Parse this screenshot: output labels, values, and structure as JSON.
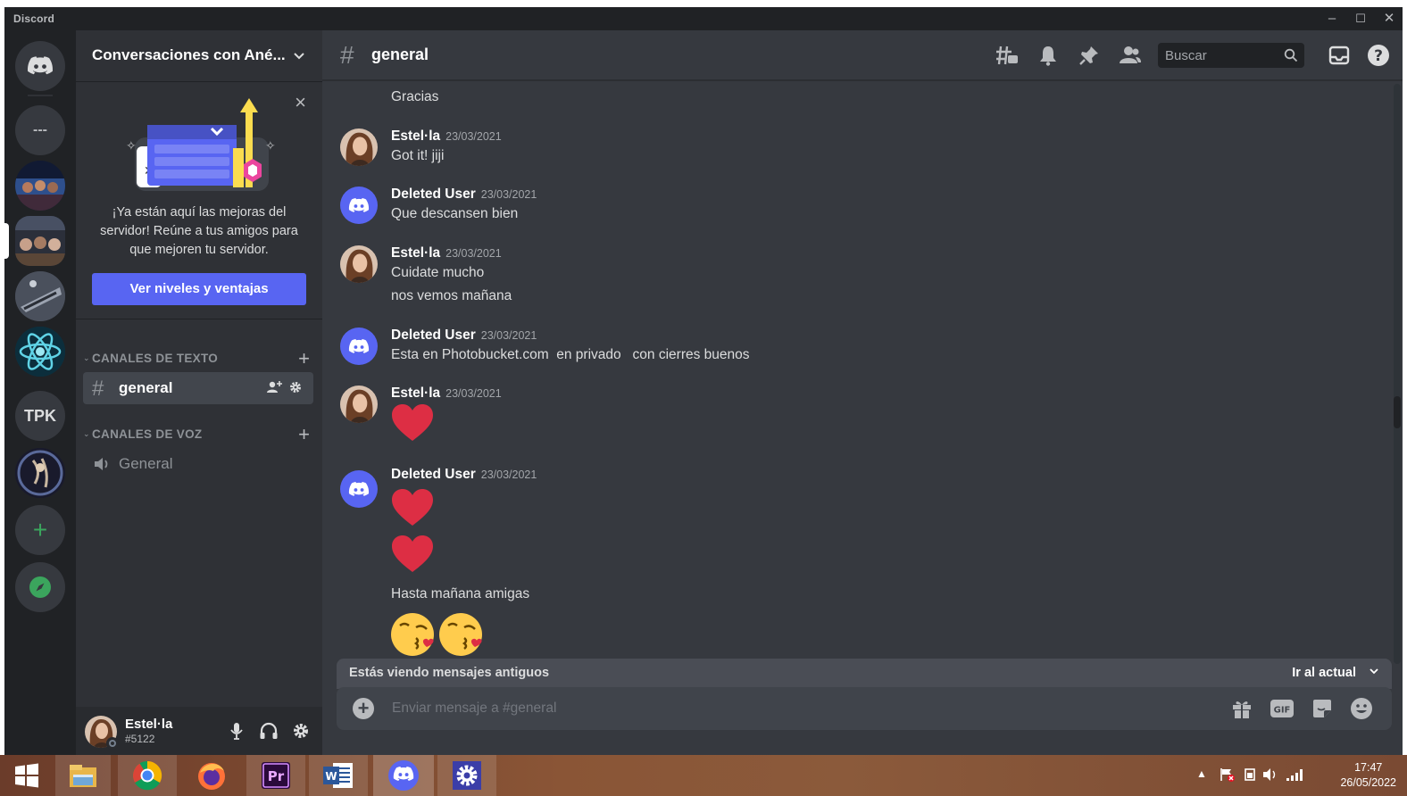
{
  "window": {
    "app_name": "Discord",
    "minimize": "–",
    "maximize": "☐",
    "close": "✕"
  },
  "rail": {
    "servers": [
      {
        "name": "home",
        "label": ""
      },
      {
        "name": "folder",
        "label": "---"
      },
      {
        "name": "server-photo-1",
        "label": ""
      },
      {
        "name": "server-photo-2",
        "label": ""
      },
      {
        "name": "server-photo-3",
        "label": ""
      },
      {
        "name": "server-atom",
        "label": ""
      },
      {
        "name": "server-tpk",
        "label": "TPK"
      },
      {
        "name": "server-art",
        "label": ""
      }
    ],
    "add_server": "+",
    "explore": "explore"
  },
  "guild": {
    "name": "Conversaciones con Ané..."
  },
  "promo": {
    "text": "¡Ya están aquí las mejoras del servidor! Reúne a tus amigos para que mejoren tu servidor.",
    "button": "Ver niveles y ventajas",
    "close": "×"
  },
  "categories": {
    "text": {
      "label": "CANALES DE TEXTO",
      "add": "+"
    },
    "voice": {
      "label": "CANALES DE VOZ",
      "add": "+"
    }
  },
  "channels": {
    "text": [
      {
        "name": "general",
        "icon": "#"
      }
    ],
    "voice": [
      {
        "name": "General",
        "icon": "speaker-icon"
      }
    ]
  },
  "user": {
    "name": "Estel·la",
    "tag": "#5122"
  },
  "chat": {
    "channel": "general",
    "hash": "#",
    "search_placeholder": "Buscar",
    "messages": [
      {
        "lines": [
          "Gracias"
        ]
      },
      {
        "author": "Estel·la",
        "time": "23/03/2021",
        "lines": [
          "Got it! jiji"
        ]
      },
      {
        "author": "Deleted User",
        "time": "23/03/2021",
        "lines": [
          "Que descansen bien"
        ]
      },
      {
        "author": "Estel·la",
        "time": "23/03/2021",
        "lines": [
          "Cuidate mucho",
          "nos vemos mañana"
        ]
      },
      {
        "author": "Deleted User",
        "time": "23/03/2021",
        "lines": [
          "Esta en Photobucket.com  en privado   con cierres buenos"
        ]
      },
      {
        "author": "Estel·la",
        "time": "23/03/2021",
        "lines": [
          "heart-emoji"
        ]
      },
      {
        "author": "Deleted User",
        "time": "23/03/2021",
        "lines": [
          "heart-emoji",
          "heart-emoji",
          "Hasta mañana amigas",
          "kiss-emoji kiss-emoji"
        ]
      }
    ],
    "old_messages": {
      "text": "Estás viendo mensajes antiguos",
      "jump": "Ir al actual"
    },
    "composer_placeholder": "Enviar mensaje a #general"
  },
  "taskbar": {
    "apps": [
      "windows-start",
      "file-explorer",
      "chrome",
      "firefox",
      "premiere-pro",
      "word",
      "discord",
      "settings"
    ],
    "clock_time": "17:47",
    "clock_date": "26/05/2022",
    "premiere_label": "Pr",
    "word_label": "W"
  },
  "colors": {
    "blurple": "#5865f2",
    "green": "#3ba55d",
    "heart": "#dd2e44"
  }
}
